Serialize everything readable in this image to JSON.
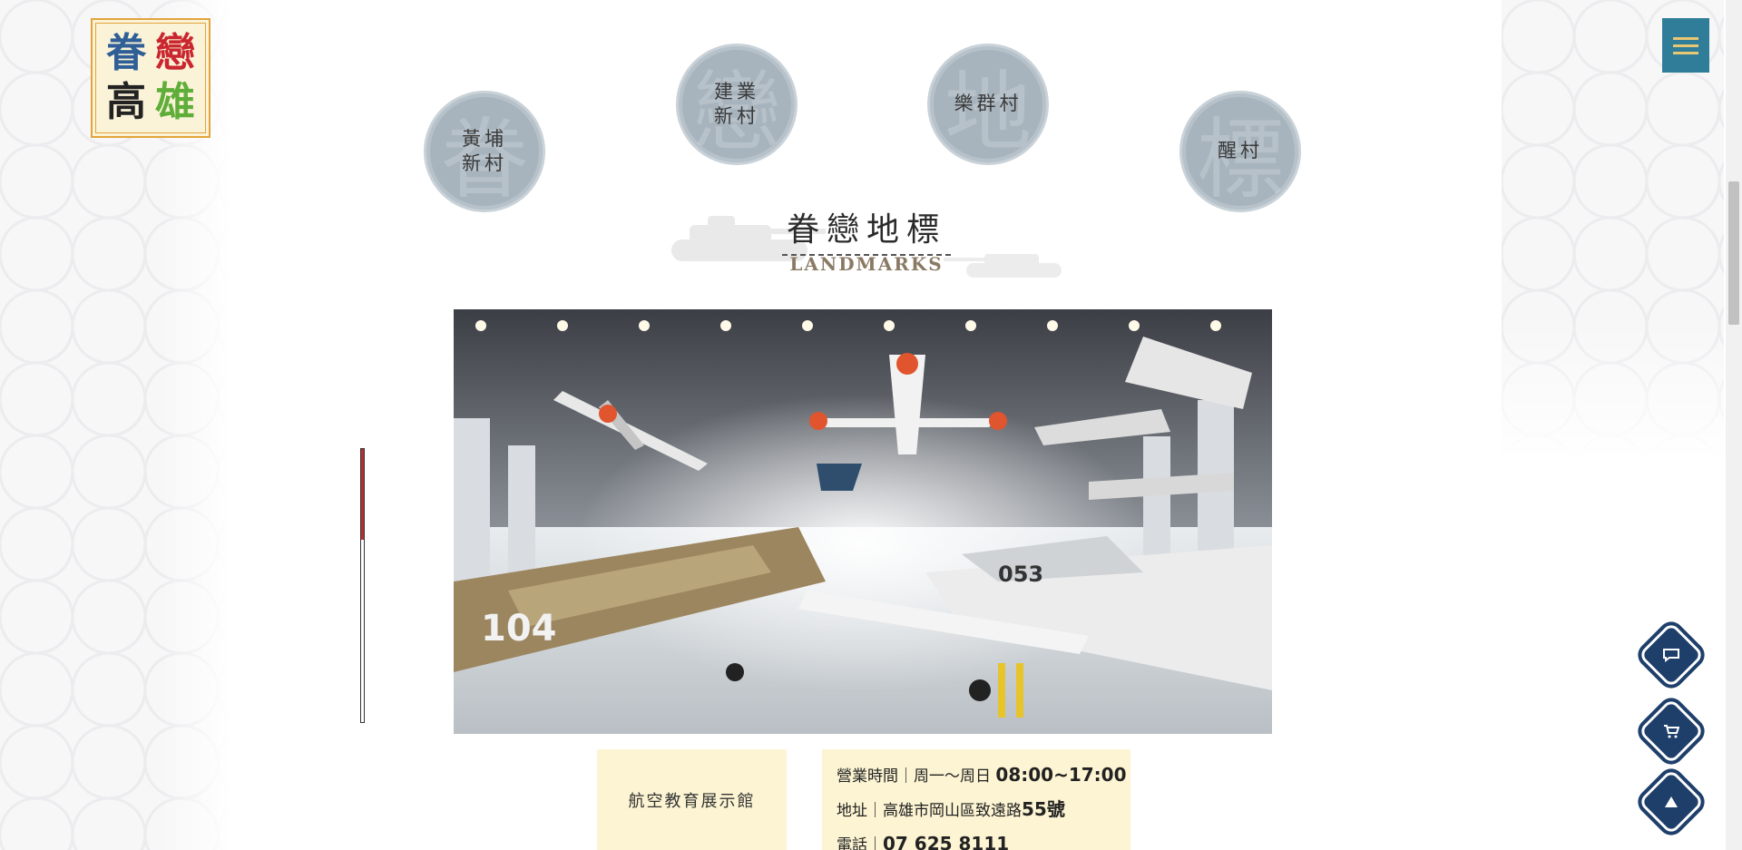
{
  "logo": {
    "chars": [
      "眷",
      "戀",
      "高",
      "雄"
    ]
  },
  "menu": {
    "icon": "hamburger-icon"
  },
  "villages": [
    {
      "name_line1": "黃埔",
      "name_line2": "新村",
      "glyph": "眷"
    },
    {
      "name_line1": "建業",
      "name_line2": "新村",
      "glyph": "戀"
    },
    {
      "name_line1": "樂群村",
      "name_line2": "",
      "glyph": "地"
    },
    {
      "name_line1": "醒村",
      "name_line2": "",
      "glyph": "標"
    }
  ],
  "section": {
    "title_zh": "眷戀地標",
    "title_en": "LANDMARKS"
  },
  "landmark": {
    "name": "航空教育展示館",
    "hours_label": "營業時間｜周一～周日",
    "hours_value": "08:00~17:00",
    "address_label": "地址｜高雄市岡山區致遠路",
    "address_value": "55號",
    "phone_label": "電話｜",
    "phone_value": "07 625 8111",
    "photo_plane_label_1": "104",
    "photo_plane_label_2": "053"
  },
  "floating_buttons": [
    {
      "icon": "chat-icon"
    },
    {
      "icon": "cart-icon"
    },
    {
      "icon": "scroll-top-icon"
    }
  ],
  "colors": {
    "accent_blue": "#2f7d99",
    "circle_gray": "#a8b4bd",
    "info_bg": "#fcf4d2",
    "navy": "#1f3f6b",
    "scroll_red": "#b5302f"
  }
}
